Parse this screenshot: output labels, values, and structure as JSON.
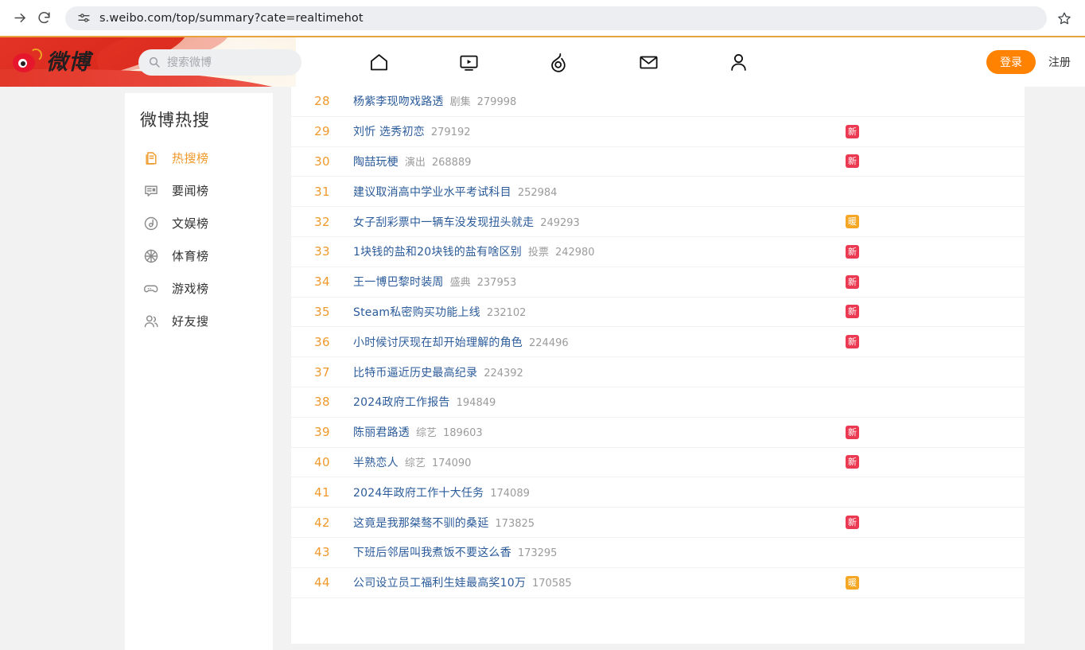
{
  "browser": {
    "url": "s.weibo.com/top/summary?cate=realtimehot",
    "forward_icon": "forward-arrow-icon",
    "reload_icon": "reload-icon",
    "tune_icon": "site-settings-icon",
    "star_icon": "bookmark-star-icon"
  },
  "header": {
    "logo_text": "微博",
    "search_placeholder": "搜索微博",
    "login_label": "登录",
    "register_label": "注册",
    "nav": [
      {
        "name": "home-icon",
        "label": "首页"
      },
      {
        "name": "video-icon",
        "label": "视频"
      },
      {
        "name": "hot-flame-icon",
        "label": "热搜"
      },
      {
        "name": "mail-icon",
        "label": "消息"
      },
      {
        "name": "user-icon",
        "label": "我"
      }
    ],
    "accent_orange": "#ff8200",
    "top_border": "#e8a33d"
  },
  "sidebar": {
    "title": "微博热搜",
    "items": [
      {
        "label": "热搜榜",
        "icon": "hot-list-icon",
        "active": true
      },
      {
        "label": "要闻榜",
        "icon": "news-icon",
        "active": false
      },
      {
        "label": "文娱榜",
        "icon": "entertainment-icon",
        "active": false
      },
      {
        "label": "体育榜",
        "icon": "sports-ball-icon",
        "active": false
      },
      {
        "label": "游戏榜",
        "icon": "gamepad-icon",
        "active": false
      },
      {
        "label": "好友搜",
        "icon": "friends-icon",
        "active": false
      }
    ]
  },
  "hot_list": {
    "rank_color": "#f0992b",
    "title_color": "#2b5b9a",
    "rows": [
      {
        "rank": "28",
        "title": "杨紫李现吻戏路透",
        "tag": "剧集",
        "count": "279998",
        "badge": ""
      },
      {
        "rank": "29",
        "title": "刘忻 选秀初恋",
        "tag": "",
        "count": "279192",
        "badge": "新"
      },
      {
        "rank": "30",
        "title": "陶喆玩梗",
        "tag": "演出",
        "count": "268889",
        "badge": "新"
      },
      {
        "rank": "31",
        "title": "建议取消高中学业水平考试科目",
        "tag": "",
        "count": "252984",
        "badge": ""
      },
      {
        "rank": "32",
        "title": "女子刮彩票中一辆车没发现扭头就走",
        "tag": "",
        "count": "249293",
        "badge": "暖"
      },
      {
        "rank": "33",
        "title": "1块钱的盐和20块钱的盐有啥区别",
        "tag": "投票",
        "count": "242980",
        "badge": "新"
      },
      {
        "rank": "34",
        "title": "王一博巴黎时装周",
        "tag": "盛典",
        "count": "237953",
        "badge": "新"
      },
      {
        "rank": "35",
        "title": "Steam私密购买功能上线",
        "tag": "",
        "count": "232102",
        "badge": "新"
      },
      {
        "rank": "36",
        "title": "小时候讨厌现在却开始理解的角色",
        "tag": "",
        "count": "224496",
        "badge": "新"
      },
      {
        "rank": "37",
        "title": "比特币逼近历史最高纪录",
        "tag": "",
        "count": "224392",
        "badge": ""
      },
      {
        "rank": "38",
        "title": "2024政府工作报告",
        "tag": "",
        "count": "194849",
        "badge": ""
      },
      {
        "rank": "39",
        "title": "陈丽君路透",
        "tag": "综艺",
        "count": "189603",
        "badge": "新"
      },
      {
        "rank": "40",
        "title": "半熟恋人",
        "tag": "综艺",
        "count": "174090",
        "badge": "新"
      },
      {
        "rank": "41",
        "title": "2024年政府工作十大任务",
        "tag": "",
        "count": "174089",
        "badge": ""
      },
      {
        "rank": "42",
        "title": "这竟是我那桀骜不驯的桑延",
        "tag": "",
        "count": "173825",
        "badge": "新"
      },
      {
        "rank": "43",
        "title": "下班后邻居叫我煮饭不要这么香",
        "tag": "",
        "count": "173295",
        "badge": ""
      },
      {
        "rank": "44",
        "title": "公司设立员工福利生娃最高奖10万",
        "tag": "",
        "count": "170585",
        "badge": "暖"
      }
    ]
  }
}
